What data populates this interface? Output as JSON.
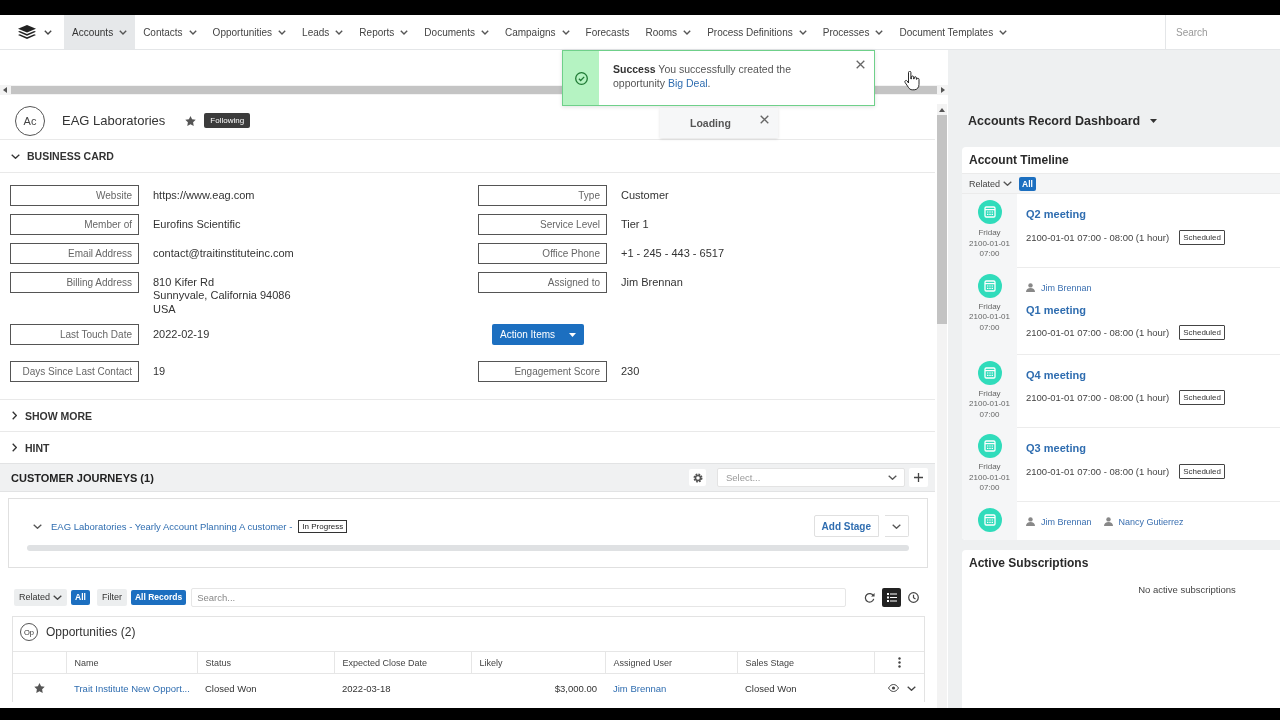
{
  "nav": {
    "menu_items": [
      {
        "label": "Accounts",
        "selected": true,
        "dropdown": true
      },
      {
        "label": "Contacts",
        "selected": false,
        "dropdown": true
      },
      {
        "label": "Opportunities",
        "selected": false,
        "dropdown": true
      },
      {
        "label": "Leads",
        "selected": false,
        "dropdown": true
      },
      {
        "label": "Reports",
        "selected": false,
        "dropdown": true
      },
      {
        "label": "Documents",
        "selected": false,
        "dropdown": true
      },
      {
        "label": "Campaigns",
        "selected": false,
        "dropdown": true
      },
      {
        "label": "Forecasts",
        "selected": false,
        "dropdown": false
      },
      {
        "label": "Rooms",
        "selected": false,
        "dropdown": true
      },
      {
        "label": "Process Definitions",
        "selected": false,
        "dropdown": true
      },
      {
        "label": "Processes",
        "selected": false,
        "dropdown": true
      },
      {
        "label": "Document Templates",
        "selected": false,
        "dropdown": true
      }
    ],
    "search": {
      "placeholder": "Search"
    }
  },
  "notification": {
    "title": "Success",
    "message": "You successfully created the opportunity",
    "link": "Big Deal",
    "suffix": "."
  },
  "loading": {
    "label": "Loading"
  },
  "record": {
    "avatar": "Ac",
    "name": "EAG Laboratories",
    "follow_status": "Following"
  },
  "business_card": {
    "title": "BUSINESS CARD",
    "expanded": true,
    "fields": [
      {
        "label": "Website",
        "value": "https://www.eag.com",
        "kind": "link"
      },
      {
        "label": "Type",
        "value": "Customer",
        "kind": "text"
      },
      {
        "label": "Member of",
        "value": "Eurofins Scientific",
        "kind": "link"
      },
      {
        "label": "Service Level",
        "value": "Tier 1",
        "kind": "text"
      },
      {
        "label": "Email Address",
        "value": "contact@traitinstituteinc.com",
        "kind": "link"
      },
      {
        "label": "Office Phone",
        "value": "+1 - 245 - 443 - 6517",
        "kind": "link"
      },
      {
        "label": "Billing Address",
        "lines": [
          "810 Kifer Rd",
          "Sunnyvale, California 94086",
          "USA"
        ],
        "kind": "address"
      },
      {
        "label": "Assigned to",
        "value": "Jim Brennan",
        "kind": "link"
      },
      {
        "label": "Last Touch Date",
        "value": "2022-02-19",
        "kind": "text"
      },
      {
        "label": "Action Items",
        "kind": "button"
      },
      {
        "label": "Days Since Last Contact",
        "value": "19",
        "kind": "text"
      },
      {
        "label": "Engagement Score",
        "value": "230",
        "kind": "text"
      }
    ]
  },
  "sections": [
    {
      "title": "SHOW MORE",
      "expanded": false
    },
    {
      "title": "HINT",
      "expanded": false
    }
  ],
  "customer_journeys": {
    "title": "CUSTOMER JOURNEYS (1)",
    "select": {
      "placeholder": "Select..."
    },
    "journeys": [
      {
        "name": "EAG Laboratories - Yearly Account Planning A customer -",
        "status": "In Progress",
        "expanded": true,
        "action": "Add Stage"
      }
    ]
  },
  "related_records": {
    "related": {
      "label": "Related",
      "value": "All"
    },
    "filter": {
      "label": "Filter",
      "value": "All Records"
    },
    "search": {
      "placeholder": "Search..."
    },
    "view_buttons": [
      {
        "kind": "list",
        "selected": true
      },
      {
        "kind": "history",
        "selected": false
      }
    ],
    "opportunities": {
      "badge": "Op",
      "title": "Opportunities (2)",
      "columns": [
        {
          "label": "Name",
          "kind": "link"
        },
        {
          "label": "Status",
          "kind": "text"
        },
        {
          "label": "Expected Close Date",
          "kind": "text"
        },
        {
          "label": "Likely",
          "kind": "amount"
        },
        {
          "label": "Assigned User",
          "kind": "link"
        },
        {
          "label": "Sales Stage",
          "kind": "text"
        }
      ],
      "rows": [
        {
          "cells": [
            "Trait Institute New Opport...",
            "Closed Won",
            "2022-03-18",
            "$3,000.00",
            "Jim Brennan",
            "Closed Won"
          ]
        }
      ]
    }
  },
  "dashboard": {
    "title": "Accounts Record Dashboard",
    "timeline": {
      "title": "Account Timeline",
      "related": {
        "label": "Related",
        "value": "All"
      },
      "events": [
        {
          "date_lines": [
            "Friday",
            "2100-01-01",
            "07:00"
          ],
          "title": "Q2 meeting",
          "when": "2100-01-01 07:00 - 08:00 (1 hour)",
          "status": "Scheduled"
        },
        {
          "date_lines": [
            "Friday",
            "2100-01-01",
            "07:00"
          ],
          "people": [
            "Jim Brennan"
          ],
          "title": "Q1 meeting",
          "when": "2100-01-01 07:00 - 08:00 (1 hour)",
          "status": "Scheduled"
        },
        {
          "date_lines": [
            "Friday",
            "2100-01-01",
            "07:00"
          ],
          "title": "Q4 meeting",
          "when": "2100-01-01 07:00 - 08:00 (1 hour)",
          "status": "Scheduled"
        },
        {
          "date_lines": [
            "Friday",
            "2100-01-01",
            "07:00"
          ],
          "title": "Q3 meeting",
          "when": "2100-01-01 07:00 - 08:00 (1 hour)",
          "status": "Scheduled"
        },
        {
          "people": [
            "Jim Brennan",
            "Nancy Gutierrez"
          ]
        }
      ]
    },
    "subscriptions": {
      "title": "Active Subscriptions",
      "empty_text": "No active subscriptions"
    }
  }
}
